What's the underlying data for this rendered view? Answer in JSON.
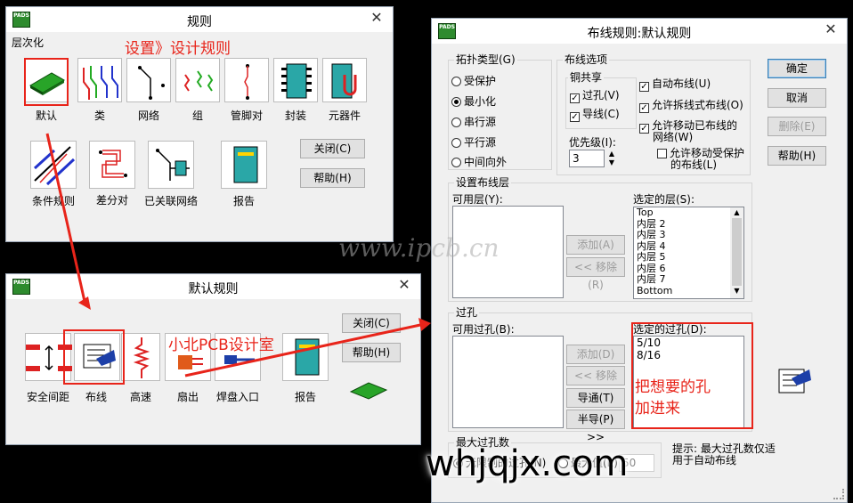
{
  "win1": {
    "title": "规则",
    "group": "层次化",
    "tools": [
      {
        "label": "默认"
      },
      {
        "label": "类"
      },
      {
        "label": "网络"
      },
      {
        "label": "组"
      },
      {
        "label": "管脚对"
      },
      {
        "label": "封装"
      },
      {
        "label": "元器件"
      }
    ],
    "tools2": [
      {
        "label": "条件规则"
      },
      {
        "label": "差分对"
      },
      {
        "label": "已关联网络"
      },
      {
        "label": "报告"
      }
    ],
    "close_btn": "关闭(C)",
    "help_btn": "帮助(H)",
    "annotation": "设置》设计规则"
  },
  "win2": {
    "title": "默认规则",
    "tools": [
      {
        "label": "安全间距"
      },
      {
        "label": "布线"
      },
      {
        "label": "高速"
      },
      {
        "label": "扇出"
      },
      {
        "label": "焊盘入口"
      },
      {
        "label": "报告"
      }
    ],
    "close_btn": "关闭(C)",
    "help_btn": "帮助(H)",
    "annotation": "小北PCB设计室"
  },
  "win3": {
    "title": "布线规则:默认规则",
    "topo": {
      "title": "拓扑类型(G)",
      "options": [
        "受保护",
        "最小化",
        "串行源",
        "平行源",
        "中间向外"
      ],
      "selected": "最小化"
    },
    "routing": {
      "title": "布线选项",
      "copper_title": "铜共享",
      "via": "过孔(V)",
      "trace": "导线(C)",
      "auto_route": "自动布线(U)",
      "allow_rip": "允许拆线式布线(O)",
      "allow_move_1": "允许移动已布线的",
      "allow_move_2": "网络(W)",
      "allow_protect_1": "允许移动受保护",
      "allow_protect_2": "的布线(L)",
      "priority_label": "优先级(I):",
      "priority_value": "3"
    },
    "layers": {
      "title": "设置布线层",
      "available": "可用层(Y):",
      "selected": "选定的层(S):",
      "selected_items": [
        "Top",
        "内层 2",
        "内层 3",
        "内层 4",
        "内层 5",
        "内层 6",
        "内层 7",
        "Bottom"
      ],
      "add": "添加(A) >>",
      "remove": "<< 移除(R)"
    },
    "vias": {
      "title": "过孔",
      "available": "可用过孔(B):",
      "selected": "选定的过孔(D):",
      "selected_items": [
        "5/10",
        "8/16"
      ],
      "add": "添加(D) >>",
      "remove": "<< 移除(M)",
      "guide": "导通(T) >>",
      "half": "半导(P) >>"
    },
    "max_via": {
      "title": "最大过孔数",
      "unlimited": "无限制的过孔(N)",
      "max_value": "最大值(E)",
      "value": "50"
    },
    "hint": "提示: 最大过孔数仅适用于自动布线",
    "ok": "确定",
    "cancel": "取消",
    "delete": "删除(E)",
    "help": "帮助(H)",
    "annotation_1": "把想要的孔",
    "annotation_2": "加进来"
  },
  "watermark_1": "www.ipcb.cn",
  "watermark_2": "whjqjx.com",
  "colors": {
    "annotation": "#e8241a",
    "chrome_bg": "#f0f0f0",
    "desktop": "#000000"
  }
}
